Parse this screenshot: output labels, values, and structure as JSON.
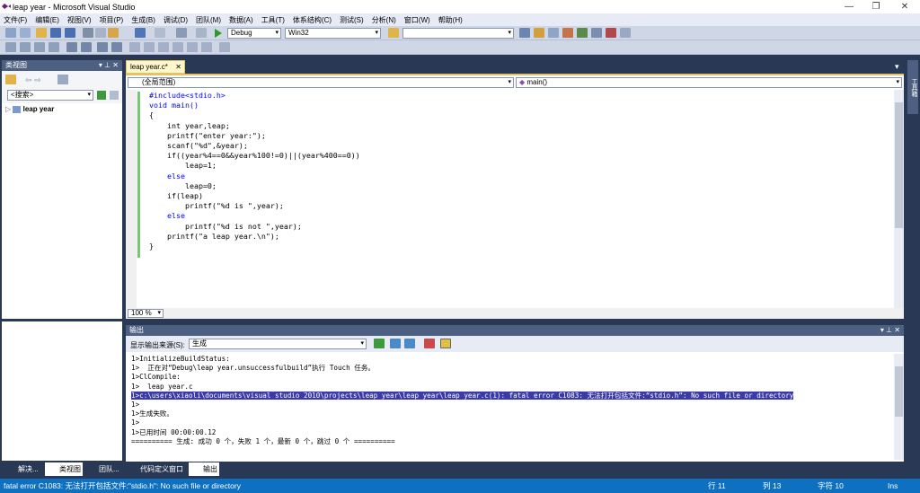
{
  "window": {
    "title": "leap year - Microsoft Visual Studio"
  },
  "menu": [
    "文件(F)",
    "编辑(E)",
    "视图(V)",
    "项目(P)",
    "生成(B)",
    "调试(D)",
    "团队(M)",
    "数据(A)",
    "工具(T)",
    "体系结构(C)",
    "测试(S)",
    "分析(N)",
    "窗口(W)",
    "帮助(H)"
  ],
  "toolbar": {
    "config": "Debug",
    "platform": "Win32",
    "find": ""
  },
  "class_view": {
    "title": "类视图",
    "search_placeholder": "<搜索>",
    "tree_item": "leap year"
  },
  "editor": {
    "tab_label": "leap year.c*",
    "scope": "(全局范围)",
    "member": "main()",
    "zoom": "100 %",
    "lines": [
      "#include<stdio.h>",
      "void main()",
      "{",
      "    int year,leap;",
      "    printf(\"enter year:\");",
      "    scanf(\"%d\",&year);",
      "    if((year%4==0&&year%100!=0)||(year%400==0))",
      "        leap=1;",
      "    else",
      "        leap=0;",
      "    if(leap)",
      "        printf(\"%d is \",year);",
      "    else",
      "        printf(\"%d is not \",year);",
      "    printf(\"a leap year.\\n\");",
      "}"
    ]
  },
  "output": {
    "title": "输出",
    "source_label": "显示输出来源(S):",
    "source_value": "生成",
    "lines": [
      "1>InitializeBuildStatus:",
      "1>  正在对“Debug\\leap year.unsuccessfulbuild”执行 Touch 任务。",
      "1>ClCompile:",
      "1>  leap year.c",
      "1>c:\\users\\xiaoli\\documents\\visual studio 2010\\projects\\leap year\\leap year\\leap year.c(1): fatal error C1083: 无法打开包括文件:“stdio.h”: No such file or directory",
      "1>",
      "1>生成失败。",
      "1>",
      "1>已用时间 00:00:00.12",
      "========== 生成: 成功 0 个，失败 1 个，最新 0 个，跳过 0 个 =========="
    ],
    "highlight_index": 4
  },
  "bottom_tabs": [
    "解决...",
    "类视图",
    "团队...",
    "代码定义窗口",
    "输出"
  ],
  "right_rail": "工具箱",
  "status": {
    "message": "fatal error C1083: 无法打开包括文件:\"stdio.h\": No such file or directory",
    "row": "行 11",
    "col": "列 13",
    "ch": "字符 10",
    "mode": "Ins"
  }
}
